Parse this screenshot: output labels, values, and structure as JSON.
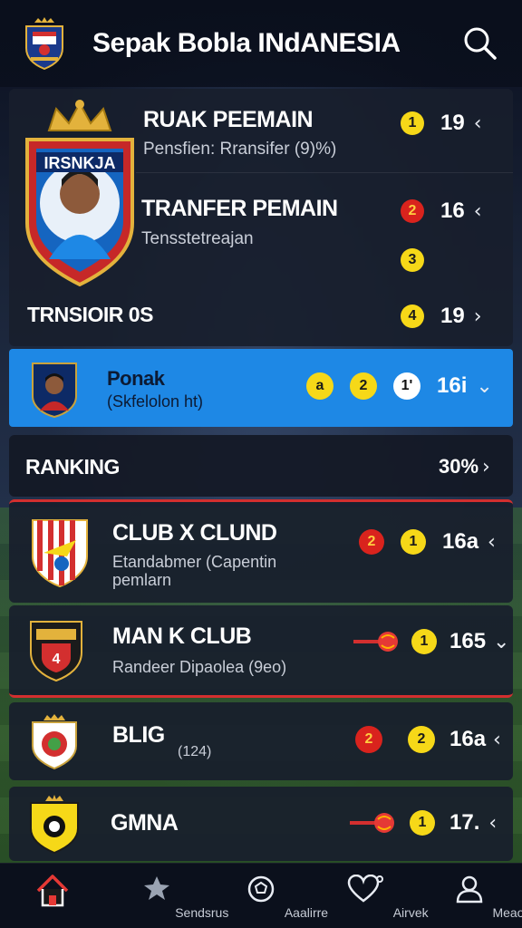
{
  "header": {
    "title": "Sepak Bobla INdANESIA",
    "logo_icon": "shield-crest-icon",
    "search_icon": "search-icon"
  },
  "player_card": {
    "row1": {
      "title": "RUAK PEEMAIN",
      "subtitle": "Pensfien: Rransifer (9)%)",
      "badge": "1",
      "value": "19",
      "chevron": "‹"
    },
    "row2": {
      "title": "TRANFER PEMAIN",
      "subtitle": "Tensstetreajan",
      "badge": "2",
      "value": "16",
      "chevron": "‹"
    },
    "row3": {
      "badge": "3"
    },
    "row4": {
      "title": "TRNSIOIR 0S",
      "badge": "4",
      "value": "19",
      "chevron": "›"
    }
  },
  "highlight_row": {
    "title": "Ponak",
    "subtitle": "(Skfelolon ht)",
    "badge1": "a",
    "badge2": "2",
    "badge3": "1'",
    "value": "16i",
    "chevron": "⌄"
  },
  "ranking": {
    "title": "RANKING",
    "value": "30%",
    "chevron": "›"
  },
  "clubs": [
    {
      "name": "CLUB X CLUND",
      "subtitle": "Etandabmer (Capentin",
      "subtitle2": "pemlarn",
      "badge_a": "2",
      "badge_b": "1",
      "value": "16a",
      "chevron": "‹"
    },
    {
      "name": "MAN K CLUB",
      "subtitle": "Randeer Dipaolea (9eo)",
      "badge_b": "1",
      "value": "165",
      "chevron": "⌄"
    },
    {
      "name": "BLIG",
      "subtitle": "(124)",
      "badge_a": "2",
      "badge_b": "2",
      "value": "16a",
      "chevron": "‹"
    },
    {
      "name": "GMNA",
      "badge_b": "1",
      "value": "17.",
      "chevron": "‹"
    }
  ],
  "bottom_nav": [
    {
      "label": "",
      "icon": "home-icon"
    },
    {
      "label": "Sendsrus",
      "icon": "star-icon"
    },
    {
      "label": "Aaalirre",
      "icon": "soccer-ball-icon"
    },
    {
      "label": "Airvek",
      "icon": "heart-icon"
    },
    {
      "label": "Meaoos",
      "icon": "user-icon"
    }
  ],
  "colors": {
    "accent_blue": "#1e88e5",
    "badge_yellow": "#f6d818",
    "badge_red": "#d9231d",
    "panel": "#181e2c"
  }
}
